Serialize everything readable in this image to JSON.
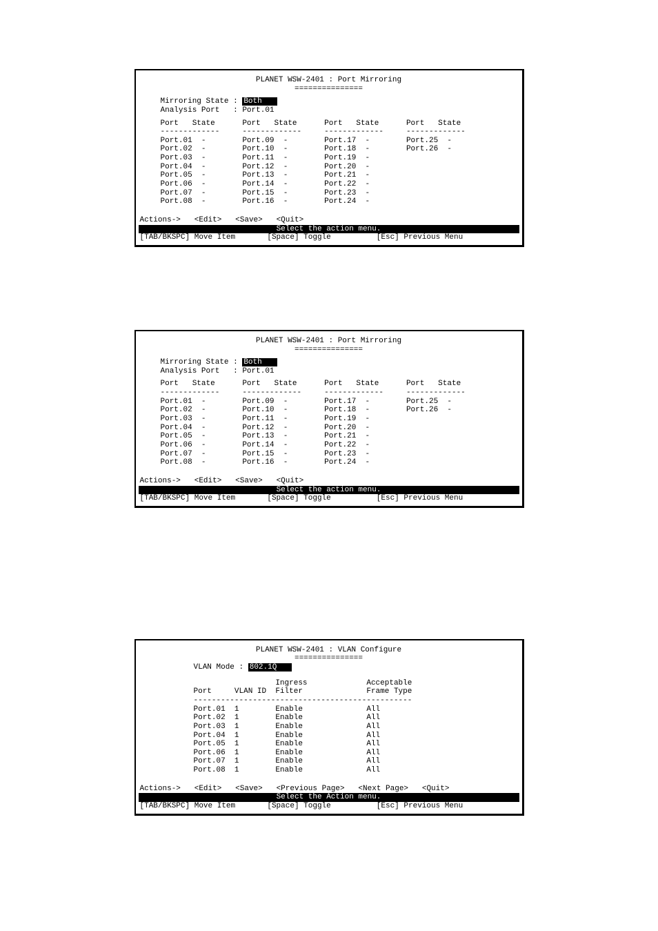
{
  "screen1": {
    "title": "PLANET WSW-2401 : Port Mirroring",
    "underline": "===============",
    "mirroring_label": "Mirroring State : ",
    "mirroring_value": "Both   ",
    "analysis_label": "Analysis Port   : ",
    "analysis_value": "Port.01",
    "header": "Port   State      Port   State      Port   State      Port   State",
    "divider": "-------------     -------------     -------------     -------------",
    "rows": [
      "Port.01  -        Port.09  -        Port.17  -        Port.25  -",
      "Port.02  -        Port.10  -        Port.18  -        Port.26  -",
      "Port.03  -        Port.11  -        Port.19  -",
      "Port.04  -        Port.12  -        Port.20  -",
      "Port.05  -        Port.13  -        Port.21  -",
      "Port.06  -        Port.14  -        Port.22  -",
      "Port.07  -        Port.15  -        Port.23  -",
      "Port.08  -        Port.16  -        Port.24  -"
    ],
    "actions_label": "Actions->",
    "actions": [
      "<Edit>",
      "<Save>",
      "<Quit>"
    ],
    "status": "Select the action menu.",
    "hint_left": "[TAB/BKSPC] Move Item",
    "hint_mid": "[Space] Toggle",
    "hint_right": "[Esc] Previous Menu"
  },
  "screen2": {
    "title": "PLANET WSW-2401 : Port Mirroring",
    "underline": "===============",
    "mirroring_label": "Mirroring State : ",
    "mirroring_value": "Both   ",
    "analysis_label": "Analysis Port   : ",
    "analysis_value": "Port.01",
    "header": "Port   State      Port   State      Port   State      Port   State",
    "divider": "-------------     -------------     -------------     -------------",
    "rows": [
      "Port.01  -        Port.09  -        Port.17  -        Port.25  -",
      "Port.02  -        Port.10  -        Port.18  -        Port.26  -",
      "Port.03  -        Port.11  -        Port.19  -",
      "Port.04  -        Port.12  -        Port.20  -",
      "Port.05  -        Port.13  -        Port.21  -",
      "Port.06  -        Port.14  -        Port.22  -",
      "Port.07  -        Port.15  -        Port.23  -",
      "Port.08  -        Port.16  -        Port.24  -"
    ],
    "actions_label": "Actions->",
    "actions": [
      "<Edit>",
      "<Save>",
      "<Quit>"
    ],
    "status": "Select the action menu.",
    "hint_left": "[TAB/BKSPC] Move Item",
    "hint_mid": "[Space] Toggle",
    "hint_right": "[Esc] Previous Menu"
  },
  "screen3": {
    "title": "PLANET WSW-2401 : VLAN Configure",
    "underline": "===============",
    "vlan_mode_label": "VLAN Mode : ",
    "vlan_mode_value": "802.1Q   ",
    "header1": "                  Ingress             Acceptable",
    "header2": "Port     VLAN ID  Filter              Frame Type",
    "divider": "------------------------------------------------",
    "rows": [
      "Port.01  1        Enable              All",
      "Port.02  1        Enable              All",
      "Port.03  1        Enable              All",
      "Port.04  1        Enable              All",
      "Port.05  1        Enable              All",
      "Port.06  1        Enable              All",
      "Port.07  1        Enable              All",
      "Port.08  1        Enable              All"
    ],
    "actions_label": "Actions->",
    "actions": [
      "<Edit>",
      "<Save>",
      "<Previous Page>",
      "<Next Page>",
      "<Quit>"
    ],
    "status": "Select the Action menu.",
    "hint_left": "[TAB/BKSPC] Move Item",
    "hint_mid": "[Space] Toggle",
    "hint_right": "[Esc] Previous Menu"
  }
}
